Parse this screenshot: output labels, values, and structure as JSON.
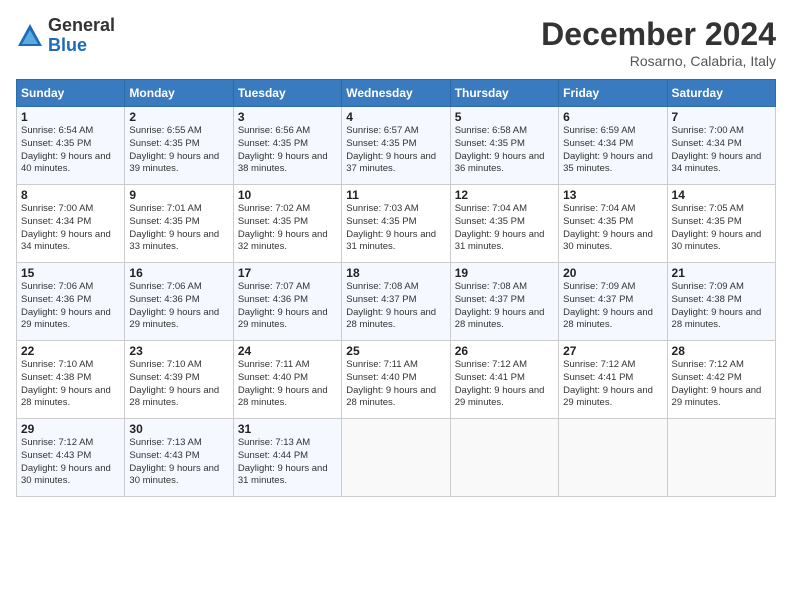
{
  "header": {
    "logo": {
      "general": "General",
      "blue": "Blue"
    },
    "title": "December 2024",
    "location": "Rosarno, Calabria, Italy"
  },
  "calendar": {
    "weekdays": [
      "Sunday",
      "Monday",
      "Tuesday",
      "Wednesday",
      "Thursday",
      "Friday",
      "Saturday"
    ],
    "weeks": [
      [
        {
          "day": "1",
          "sunrise": "6:54 AM",
          "sunset": "4:35 PM",
          "daylight": "9 hours and 40 minutes."
        },
        {
          "day": "2",
          "sunrise": "6:55 AM",
          "sunset": "4:35 PM",
          "daylight": "9 hours and 39 minutes."
        },
        {
          "day": "3",
          "sunrise": "6:56 AM",
          "sunset": "4:35 PM",
          "daylight": "9 hours and 38 minutes."
        },
        {
          "day": "4",
          "sunrise": "6:57 AM",
          "sunset": "4:35 PM",
          "daylight": "9 hours and 37 minutes."
        },
        {
          "day": "5",
          "sunrise": "6:58 AM",
          "sunset": "4:35 PM",
          "daylight": "9 hours and 36 minutes."
        },
        {
          "day": "6",
          "sunrise": "6:59 AM",
          "sunset": "4:34 PM",
          "daylight": "9 hours and 35 minutes."
        },
        {
          "day": "7",
          "sunrise": "7:00 AM",
          "sunset": "4:34 PM",
          "daylight": "9 hours and 34 minutes."
        }
      ],
      [
        {
          "day": "8",
          "sunrise": "7:00 AM",
          "sunset": "4:34 PM",
          "daylight": "9 hours and 34 minutes."
        },
        {
          "day": "9",
          "sunrise": "7:01 AM",
          "sunset": "4:35 PM",
          "daylight": "9 hours and 33 minutes."
        },
        {
          "day": "10",
          "sunrise": "7:02 AM",
          "sunset": "4:35 PM",
          "daylight": "9 hours and 32 minutes."
        },
        {
          "day": "11",
          "sunrise": "7:03 AM",
          "sunset": "4:35 PM",
          "daylight": "9 hours and 31 minutes."
        },
        {
          "day": "12",
          "sunrise": "7:04 AM",
          "sunset": "4:35 PM",
          "daylight": "9 hours and 31 minutes."
        },
        {
          "day": "13",
          "sunrise": "7:04 AM",
          "sunset": "4:35 PM",
          "daylight": "9 hours and 30 minutes."
        },
        {
          "day": "14",
          "sunrise": "7:05 AM",
          "sunset": "4:35 PM",
          "daylight": "9 hours and 30 minutes."
        }
      ],
      [
        {
          "day": "15",
          "sunrise": "7:06 AM",
          "sunset": "4:36 PM",
          "daylight": "9 hours and 29 minutes."
        },
        {
          "day": "16",
          "sunrise": "7:06 AM",
          "sunset": "4:36 PM",
          "daylight": "9 hours and 29 minutes."
        },
        {
          "day": "17",
          "sunrise": "7:07 AM",
          "sunset": "4:36 PM",
          "daylight": "9 hours and 29 minutes."
        },
        {
          "day": "18",
          "sunrise": "7:08 AM",
          "sunset": "4:37 PM",
          "daylight": "9 hours and 28 minutes."
        },
        {
          "day": "19",
          "sunrise": "7:08 AM",
          "sunset": "4:37 PM",
          "daylight": "9 hours and 28 minutes."
        },
        {
          "day": "20",
          "sunrise": "7:09 AM",
          "sunset": "4:37 PM",
          "daylight": "9 hours and 28 minutes."
        },
        {
          "day": "21",
          "sunrise": "7:09 AM",
          "sunset": "4:38 PM",
          "daylight": "9 hours and 28 minutes."
        }
      ],
      [
        {
          "day": "22",
          "sunrise": "7:10 AM",
          "sunset": "4:38 PM",
          "daylight": "9 hours and 28 minutes."
        },
        {
          "day": "23",
          "sunrise": "7:10 AM",
          "sunset": "4:39 PM",
          "daylight": "9 hours and 28 minutes."
        },
        {
          "day": "24",
          "sunrise": "7:11 AM",
          "sunset": "4:40 PM",
          "daylight": "9 hours and 28 minutes."
        },
        {
          "day": "25",
          "sunrise": "7:11 AM",
          "sunset": "4:40 PM",
          "daylight": "9 hours and 28 minutes."
        },
        {
          "day": "26",
          "sunrise": "7:12 AM",
          "sunset": "4:41 PM",
          "daylight": "9 hours and 29 minutes."
        },
        {
          "day": "27",
          "sunrise": "7:12 AM",
          "sunset": "4:41 PM",
          "daylight": "9 hours and 29 minutes."
        },
        {
          "day": "28",
          "sunrise": "7:12 AM",
          "sunset": "4:42 PM",
          "daylight": "9 hours and 29 minutes."
        }
      ],
      [
        {
          "day": "29",
          "sunrise": "7:12 AM",
          "sunset": "4:43 PM",
          "daylight": "9 hours and 30 minutes."
        },
        {
          "day": "30",
          "sunrise": "7:13 AM",
          "sunset": "4:43 PM",
          "daylight": "9 hours and 30 minutes."
        },
        {
          "day": "31",
          "sunrise": "7:13 AM",
          "sunset": "4:44 PM",
          "daylight": "9 hours and 31 minutes."
        },
        null,
        null,
        null,
        null
      ]
    ]
  }
}
